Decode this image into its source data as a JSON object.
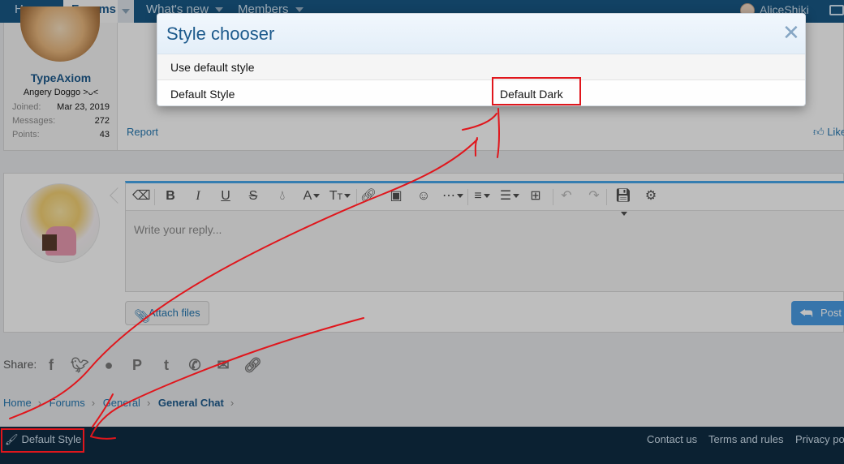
{
  "nav": {
    "home": "Home",
    "forums": "Forums",
    "whats_new": "What's new",
    "members": "Members",
    "username": "AliceShiki"
  },
  "post": {
    "username": "TypeAxiom",
    "user_title": "Angery Doggo >ᴗ<",
    "stats": [
      {
        "label": "Joined:",
        "value": "Mar 23, 2019"
      },
      {
        "label": "Messages:",
        "value": "272"
      },
      {
        "label": "Points:",
        "value": "43"
      }
    ],
    "report": "Report",
    "like": "Like"
  },
  "editor": {
    "placeholder": "Write your reply...",
    "attach": "Attach files",
    "post": "Post"
  },
  "share": {
    "label": "Share:"
  },
  "breadcrumb": {
    "items": [
      "Home",
      "Forums",
      "General"
    ],
    "current": "General Chat"
  },
  "footer": {
    "style": "Default Style",
    "links": [
      "Contact us",
      "Terms and rules",
      "Privacy po"
    ]
  },
  "modal": {
    "title": "Style chooser",
    "close": "✕",
    "use_default": "Use default style",
    "option_left": "Default Style",
    "option_right": "Default Dark"
  },
  "colors": {
    "nav": "#185886",
    "footer": "#0f2c43",
    "link": "#2577b1",
    "annotation": "#e0161c"
  }
}
